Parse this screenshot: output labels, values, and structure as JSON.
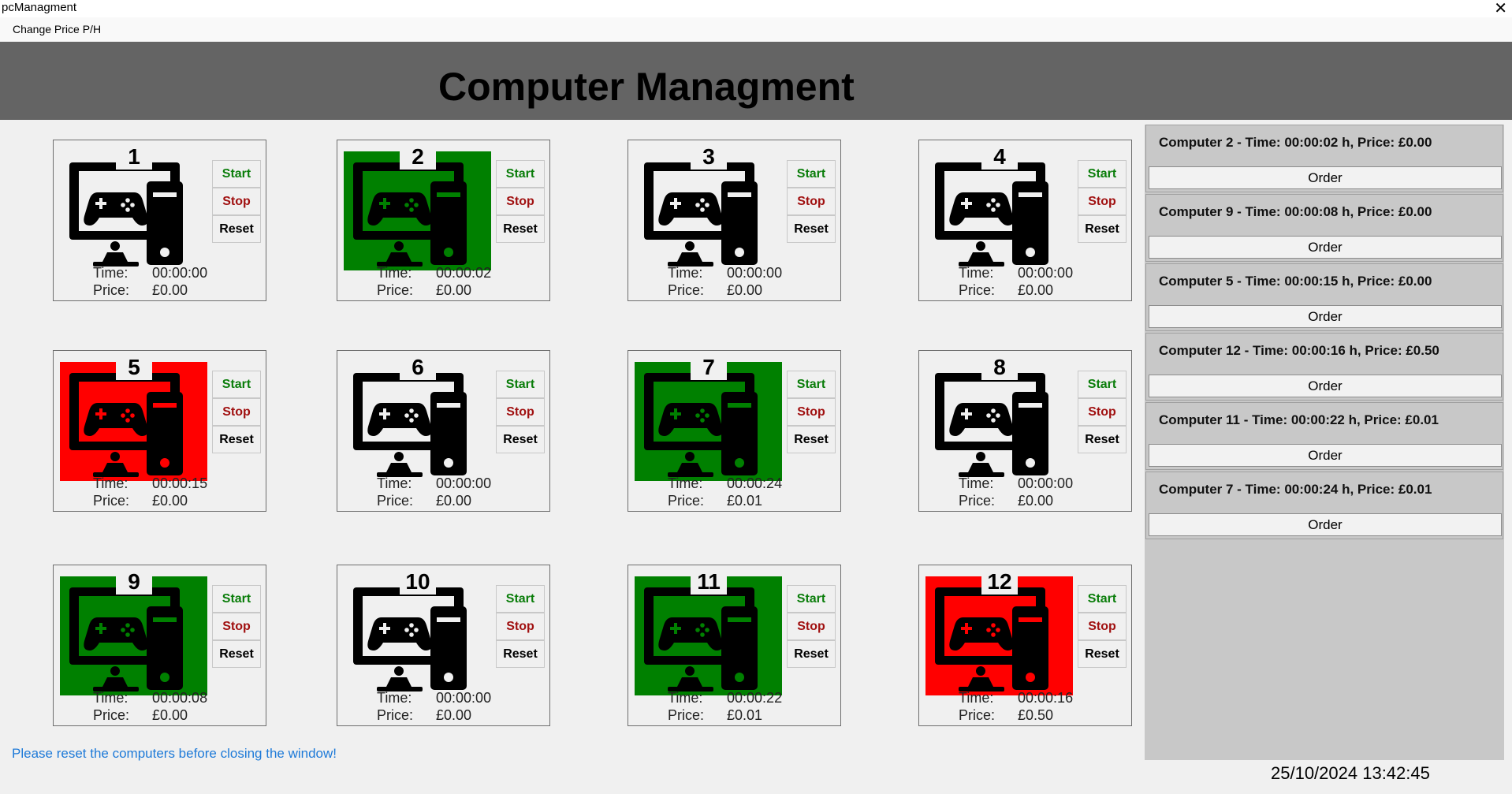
{
  "window": {
    "title": "pcManagment",
    "close_glyph": "✕"
  },
  "menu": {
    "items": [
      {
        "label": "Change Price P/H"
      }
    ]
  },
  "header": {
    "title": "Computer Managment"
  },
  "labels": {
    "time": "Time:",
    "price": "Price:",
    "start": "Start",
    "stop": "Stop",
    "reset": "Reset"
  },
  "status_colors": {
    "running": "#008000",
    "stopped": "#ff0000",
    "idle": "transparent"
  },
  "computers": [
    {
      "number": "1",
      "status": "idle",
      "time": "00:00:00",
      "price": "£0.00"
    },
    {
      "number": "2",
      "status": "running",
      "time": "00:00:02",
      "price": "£0.00"
    },
    {
      "number": "3",
      "status": "idle",
      "time": "00:00:00",
      "price": "£0.00"
    },
    {
      "number": "4",
      "status": "idle",
      "time": "00:00:00",
      "price": "£0.00"
    },
    {
      "number": "5",
      "status": "stopped",
      "time": "00:00:15",
      "price": "£0.00"
    },
    {
      "number": "6",
      "status": "idle",
      "time": "00:00:00",
      "price": "£0.00"
    },
    {
      "number": "7",
      "status": "running",
      "time": "00:00:24",
      "price": "£0.01"
    },
    {
      "number": "8",
      "status": "idle",
      "time": "00:00:00",
      "price": "£0.00"
    },
    {
      "number": "9",
      "status": "running",
      "time": "00:00:08",
      "price": "£0.00"
    },
    {
      "number": "10",
      "status": "idle",
      "time": "00:00:00",
      "price": "£0.00"
    },
    {
      "number": "11",
      "status": "running",
      "time": "00:00:22",
      "price": "£0.01"
    },
    {
      "number": "12",
      "status": "stopped",
      "time": "00:00:16",
      "price": "£0.50"
    }
  ],
  "icon_name": "gaming-pc-icon",
  "orders": [
    {
      "text": "Computer 2 - Time: 00:00:02 h, Price: £0.00",
      "button": "Order"
    },
    {
      "text": "Computer 9 - Time: 00:00:08 h, Price: £0.00",
      "button": "Order"
    },
    {
      "text": "Computer 5 - Time: 00:00:15 h, Price: £0.00",
      "button": "Order"
    },
    {
      "text": "Computer 12 - Time: 00:00:16 h, Price: £0.50",
      "button": "Order"
    },
    {
      "text": "Computer 11 - Time: 00:00:22 h, Price: £0.01",
      "button": "Order"
    },
    {
      "text": "Computer 7 - Time: 00:00:24 h, Price: £0.01",
      "button": "Order"
    }
  ],
  "footer": {
    "notice": "Please reset the computers before closing the window!",
    "datetime": "25/10/2024 13:42:45"
  }
}
